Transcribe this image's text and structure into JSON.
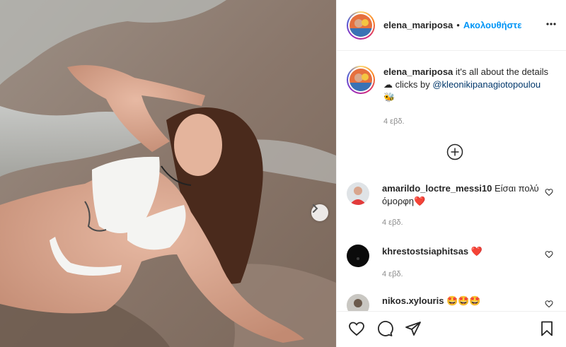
{
  "header": {
    "username": "elena_mariposa",
    "separator": "•",
    "follow_label": "Ακολουθήστε"
  },
  "caption": {
    "username": "elena_mariposa",
    "text": "it's all about the details ☁ clicks by",
    "mention": "@kleonikipanagiotopoulou",
    "emoji": "🐝",
    "time": "4 εβδ."
  },
  "comments": [
    {
      "username": "amarildo_loctre_messi10",
      "text": "Είσαι πολύ όμορφη❤️",
      "time": "4 εβδ."
    },
    {
      "username": "khrestostsiaphitsas",
      "text": "❤️",
      "time": "4 εβδ."
    },
    {
      "username": "nikos.xylouris",
      "text": "🤩🤩🤩",
      "time": ""
    }
  ],
  "icons": {
    "more": "more-horizontal-icon",
    "next": "chevron-right-icon",
    "load_more": "plus-circle-icon",
    "like": "heart-icon",
    "comment": "comment-icon",
    "share": "paper-plane-icon",
    "save": "bookmark-icon"
  },
  "colors": {
    "link_blue": "#0095f6",
    "mention": "#00376b",
    "heart_red": "#ed4956",
    "muted": "#8e8e8e"
  }
}
